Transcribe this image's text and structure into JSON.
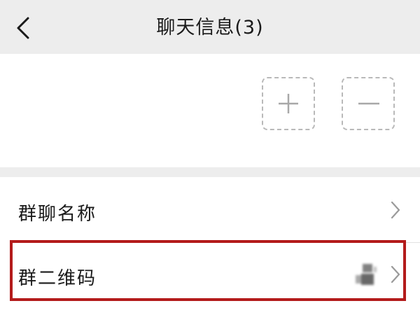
{
  "header": {
    "title": "聊天信息(3)",
    "back_icon": "chevron-left-icon"
  },
  "members": {
    "add_icon": "plus-icon",
    "remove_icon": "minus-icon"
  },
  "settings": {
    "rows": [
      {
        "label": "群聊名称",
        "icon": "chevron-right-icon"
      },
      {
        "label": "群二维码",
        "icon": "chevron-right-icon",
        "thumbnail_icon": "qr-code-icon"
      }
    ]
  },
  "colors": {
    "header_bg": "#ededed",
    "highlight": "#b31b1b",
    "dashed_border": "#b9b9b9",
    "icon_gray": "#a8a8a8"
  }
}
